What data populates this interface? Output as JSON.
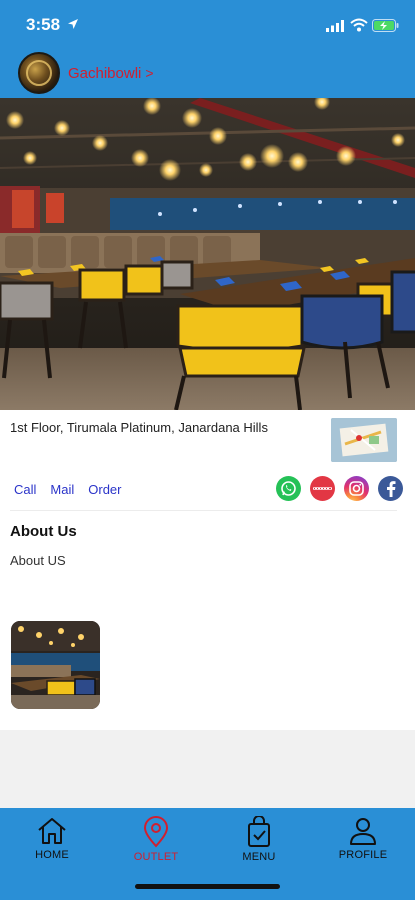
{
  "status_bar": {
    "time": "3:58"
  },
  "header": {
    "outlet_name": "Gachibowli",
    "chevron": ">"
  },
  "outlet": {
    "address": "1st Floor, Tirumala Platinum, Janardana Hills"
  },
  "actions": {
    "call": "Call",
    "mail": "Mail",
    "order": "Order"
  },
  "socials": [
    {
      "name": "whatsapp-icon"
    },
    {
      "name": "zomato-icon"
    },
    {
      "name": "instagram-icon"
    },
    {
      "name": "facebook-icon"
    }
  ],
  "about": {
    "title": "About Us",
    "text": "About US"
  },
  "nav": {
    "home": "HOME",
    "outlet": "OUTLET",
    "menu": "MENU",
    "profile": "PROFILE",
    "active": "outlet"
  },
  "colors": {
    "primary": "#2a8fd6",
    "accent_red": "#d11f2f",
    "link_blue": "#2b34c9"
  }
}
